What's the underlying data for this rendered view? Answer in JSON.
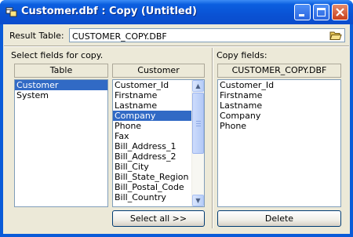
{
  "window": {
    "title": "Customer.dbf : Copy (Untitled)",
    "icons": {
      "app": "table-copy-icon",
      "minimize": "minimize-icon",
      "maximize": "maximize-icon",
      "close": "close-icon"
    }
  },
  "result_table": {
    "label": "Result Table:",
    "value": "CUSTOMER_COPY.DBF",
    "browse_icon": "open-folder-icon"
  },
  "left_panel": {
    "label": "Select fields for copy.",
    "table_header": "Table",
    "tables": [
      "Customer",
      "System"
    ],
    "selected_table": "Customer",
    "fields_header": "Customer",
    "fields": [
      "Customer_Id",
      "Firstname",
      "Lastname",
      "Company",
      "Phone",
      "Fax",
      "Bill_Address_1",
      "Bill_Address_2",
      "Bill_City",
      "Bill_State_Region",
      "Bill_Postal_Code",
      "Bill_Country"
    ],
    "selected_field": "Company",
    "select_all_label": "Select all >>"
  },
  "right_panel": {
    "label": "Copy fields:",
    "header": "CUSTOMER_COPY.DBF",
    "fields": [
      "Customer_Id",
      "Firstname",
      "Lastname",
      "Company",
      "Phone"
    ],
    "delete_label": "Delete"
  }
}
